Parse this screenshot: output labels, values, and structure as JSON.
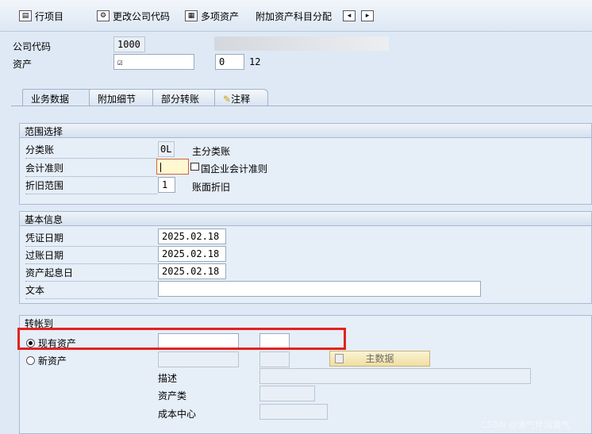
{
  "toolbar": {
    "line_items": "行项目",
    "change_company_code": "更改公司代码",
    "multiple_assets": "多项资产",
    "additional_account_assignment": "附加资产科目分配"
  },
  "header": {
    "company_code_label": "公司代码",
    "company_code_value": "1000",
    "asset_label": "资产",
    "asset_value": "",
    "sub_number": "0",
    "sub_extra": "12"
  },
  "tabs": [
    {
      "label": "业务数据"
    },
    {
      "label": "附加细节"
    },
    {
      "label": "部分转账"
    },
    {
      "label": "注释"
    }
  ],
  "scope": {
    "title": "范围选择",
    "ledger_label": "分类账",
    "ledger_value": "0L",
    "ledger_desc": "主分类账",
    "accounting_principle_label": "会计准则",
    "accounting_principle_value": "",
    "accounting_principle_desc": "国企业会计准则",
    "depr_area_label": "折旧范围",
    "depr_area_value": "1",
    "depr_area_desc": "账面折旧"
  },
  "basic": {
    "title": "基本信息",
    "doc_date_label": "凭证日期",
    "doc_date_value": "2025.02.18",
    "posting_date_label": "过账日期",
    "posting_date_value": "2025.02.18",
    "asset_value_date_label": "资产起息日",
    "asset_value_date_value": "2025.02.18",
    "text_label": "文本",
    "text_value": ""
  },
  "transfer": {
    "title": "转帐到",
    "existing_asset_label": "现有资产",
    "existing_asset_value": "",
    "existing_sub_value": "",
    "new_asset_label": "新资产",
    "master_data_button": "主数据",
    "description_label": "描述",
    "asset_class_label": "资产类",
    "cost_center_label": "成本中心"
  },
  "watermark": "CSDN @清气伴消清气"
}
